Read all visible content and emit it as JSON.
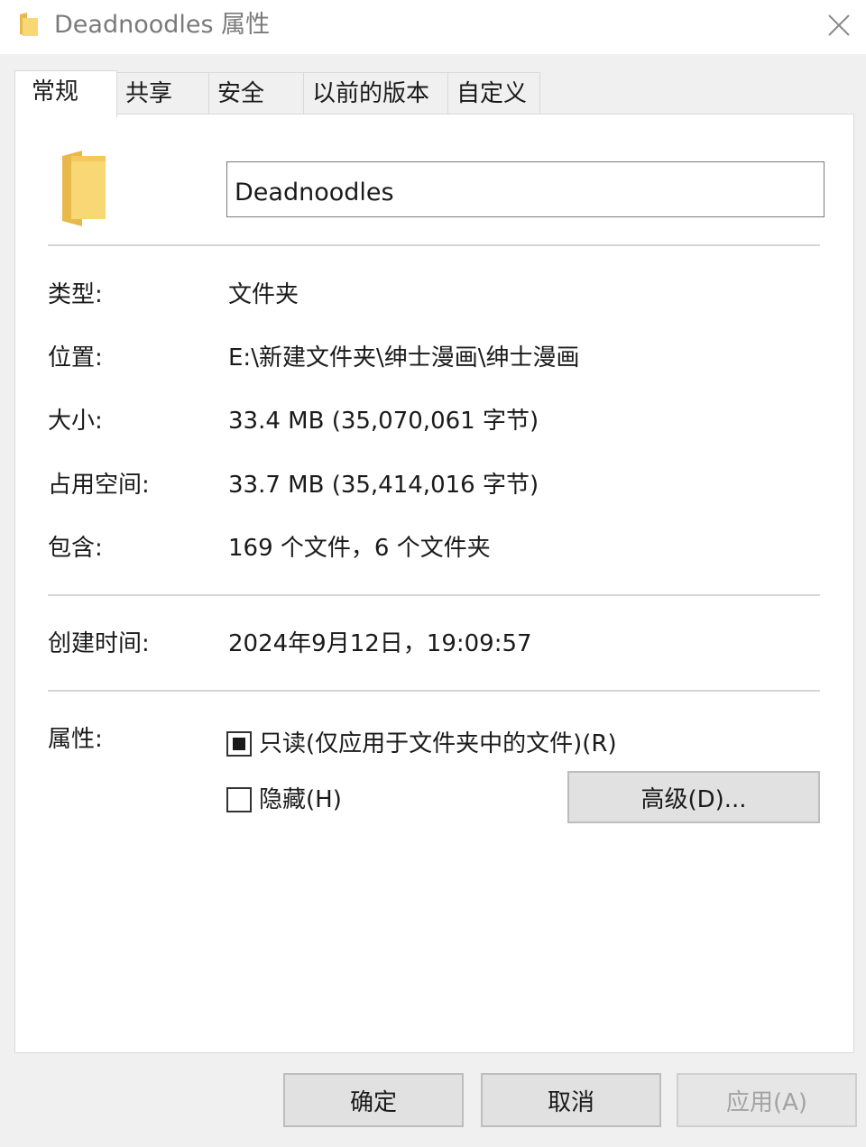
{
  "window": {
    "title": "Deadnoodles 属性",
    "close_icon": "close-icon"
  },
  "tabs": [
    {
      "label": "常规",
      "active": true
    },
    {
      "label": "共享",
      "active": false
    },
    {
      "label": "安全",
      "active": false
    },
    {
      "label": "以前的版本",
      "active": false
    },
    {
      "label": "自定义",
      "active": false
    }
  ],
  "general": {
    "folder_name": "Deadnoodles",
    "rows": [
      {
        "label": "类型:",
        "value": "文件夹"
      },
      {
        "label": "位置:",
        "value": "E:\\新建文件夹\\绅士漫画\\绅士漫画"
      },
      {
        "label": "大小:",
        "value": "33.4 MB (35,070,061 字节)"
      },
      {
        "label": "占用空间:",
        "value": "33.7 MB (35,414,016 字节)"
      },
      {
        "label": "包含:",
        "value": "169 个文件，6 个文件夹"
      }
    ],
    "created": {
      "label": "创建时间:",
      "value": "2024年9月12日，19:09:57"
    },
    "attributes": {
      "label": "属性:",
      "readonly_label": "只读(仅应用于文件夹中的文件)(R)",
      "readonly_state": "indeterminate",
      "hidden_label": "隐藏(H)",
      "hidden_checked": false,
      "advanced_label": "高级(D)..."
    }
  },
  "footer": {
    "ok_label": "确定",
    "cancel_label": "取消",
    "apply_label": "应用(A)"
  },
  "colors": {
    "folder_yellow": "#f8d775",
    "folder_dark": "#e8b84a"
  }
}
